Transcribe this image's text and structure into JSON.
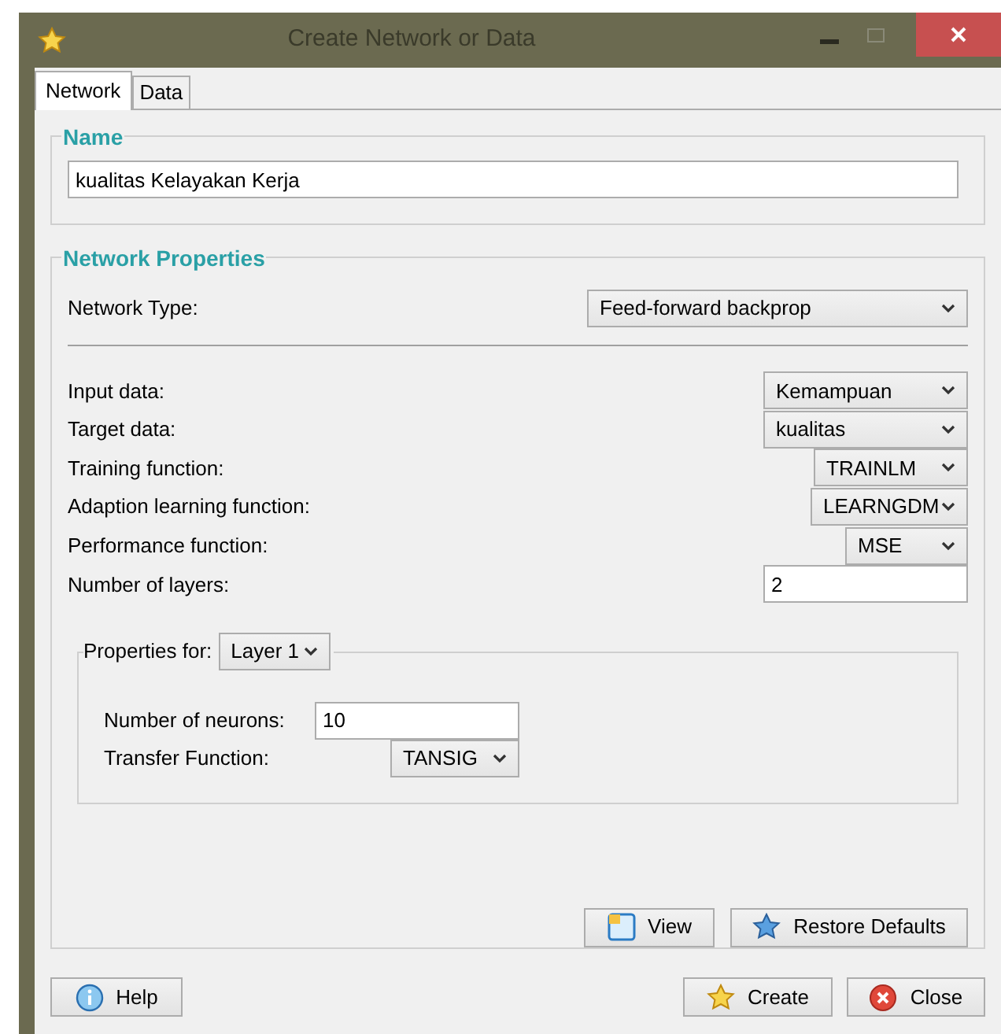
{
  "window": {
    "title": "Create Network or Data"
  },
  "tabs": [
    {
      "label": "Network",
      "selected": true
    },
    {
      "label": "Data",
      "selected": false
    }
  ],
  "name_group": {
    "title": "Name",
    "value": "kualitas Kelayakan Kerja"
  },
  "network_properties": {
    "title": "Network Properties",
    "network_type": {
      "label": "Network Type:",
      "value": "Feed-forward backprop"
    },
    "fields": [
      {
        "kind": "dropdown",
        "label": "Input data:",
        "value": "Kemampuan"
      },
      {
        "kind": "dropdown",
        "label": "Target data:",
        "value": "kualitas"
      },
      {
        "kind": "dropdown",
        "label": "Training function:",
        "value": "TRAINLM"
      },
      {
        "kind": "dropdown",
        "label": "Adaption learning function:",
        "value": "LEARNGDM"
      },
      {
        "kind": "dropdown",
        "label": "Performance function:",
        "value": "MSE"
      },
      {
        "kind": "input",
        "label": "Number of layers:",
        "value": "2"
      }
    ],
    "layer_properties": {
      "label": "Properties for:",
      "layer": "Layer 1",
      "fields": [
        {
          "kind": "input",
          "label": "Number of neurons:",
          "value": "10"
        },
        {
          "kind": "dropdown",
          "label": "Transfer Function:",
          "value": "TANSIG"
        }
      ]
    },
    "buttons": [
      {
        "kind": "view",
        "label": "View"
      },
      {
        "kind": "restore",
        "label": "Restore Defaults"
      }
    ]
  },
  "footer_buttons": [
    {
      "kind": "help",
      "label": "Help"
    },
    {
      "kind": "create",
      "label": "Create"
    },
    {
      "kind": "close",
      "label": "Close"
    }
  ]
}
